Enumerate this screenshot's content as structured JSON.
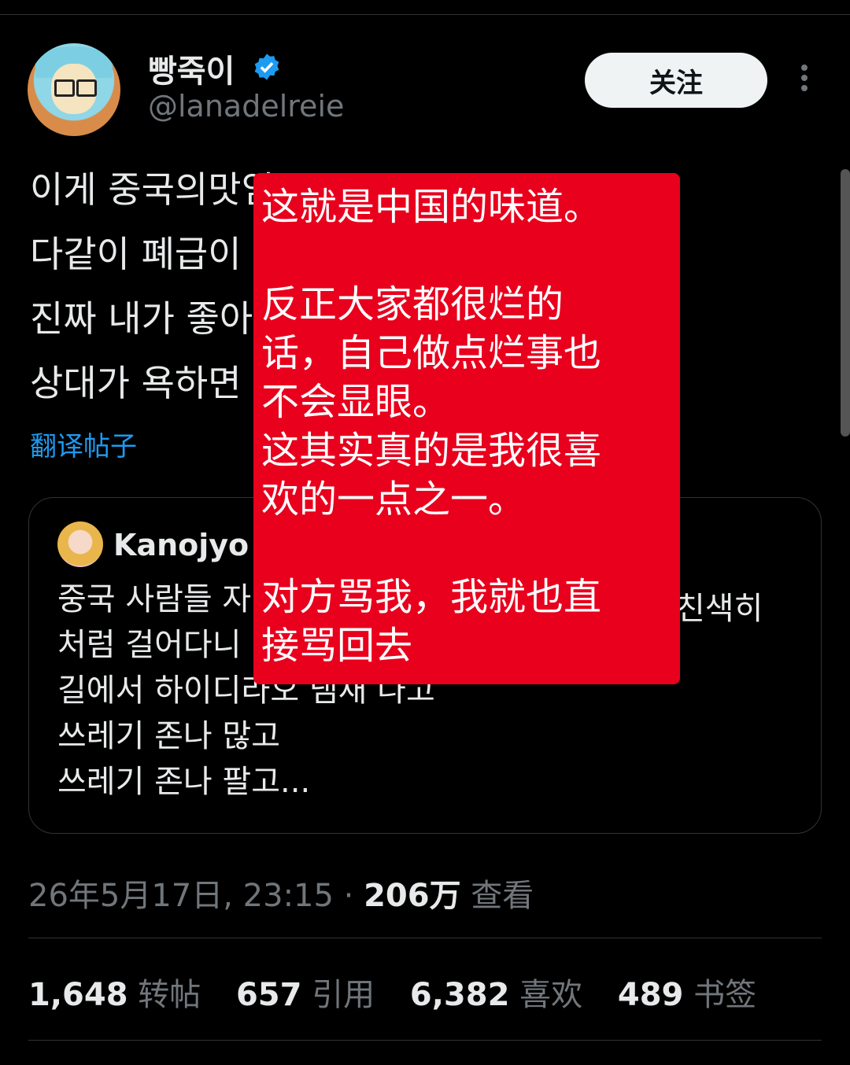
{
  "author": {
    "display_name": "빵죽이",
    "handle": "@lanadelreie"
  },
  "follow_label": "关注",
  "tweet": {
    "lines": [
      "이게 중국의맛임",
      "다같이 폐급이",
      "진짜 내가 좋아",
      "상대가 욕하면"
    ],
    "translate_label": "翻译帖子"
  },
  "quote": {
    "name": "Kanojyo",
    "lines": [
      "중국 사람들 자",
      "처럼 걸어다니",
      "길에서 하이디라오 냄새 나고",
      "쓰레기 존나 많고",
      "쓰레기 존나 팔고..."
    ],
    "line1_tail": "친색히"
  },
  "meta": {
    "date_time": "26年5月17日, 23:15 · ",
    "views_count": "206万",
    "views_label": " 查看"
  },
  "stats": [
    {
      "num": "1,648",
      "label": "转帖"
    },
    {
      "num": "657",
      "label": "引用"
    },
    {
      "num": "6,382",
      "label": "喜欢"
    },
    {
      "num": "489",
      "label": "书签"
    }
  ],
  "overlay": {
    "text": "这就是中国的味道。\n\n反正大家都很烂的\n话，自己做点烂事也\n不会显眼。\n这其实真的是我很喜\n欢的一点之一。\n\n对方骂我，我就也直\n接骂回去"
  },
  "colors": {
    "background": "#000000",
    "accent_link": "#1d9bf0",
    "overlay_red": "#e8001d"
  }
}
